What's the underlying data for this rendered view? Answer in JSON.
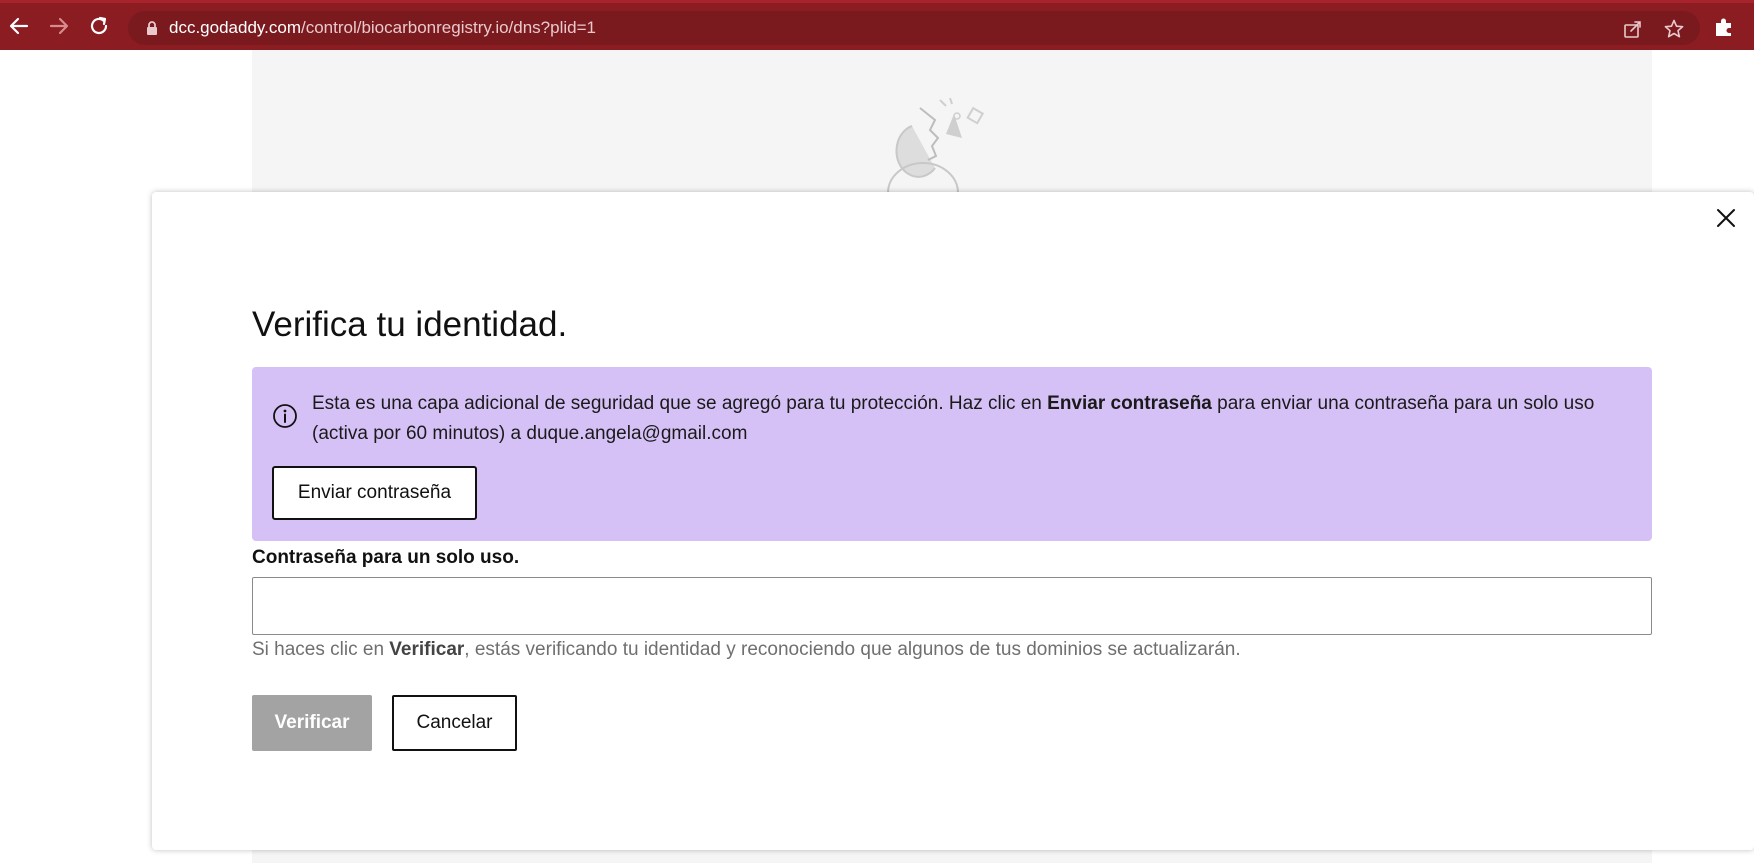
{
  "browser": {
    "url_host": "dcc.godaddy.com",
    "url_path": "/control/biocarbonregistry.io/dns?plid=1",
    "icons": {
      "back": "back-arrow-icon",
      "forward": "forward-arrow-icon",
      "reload": "reload-icon",
      "lock": "lock-icon",
      "share": "share-icon",
      "bookmark": "star-icon",
      "extensions": "puzzle-icon"
    }
  },
  "modal": {
    "title": "Verifica tu identidad.",
    "info": {
      "text_before": "Esta es una capa adicional de seguridad que se agregó para tu protección. Haz clic en ",
      "text_bold": "Enviar contraseña",
      "text_after": " para enviar una contraseña para un solo uso (activa por 60 minutos) a duque.angela@gmail.com",
      "send_button_label": "Enviar contraseña"
    },
    "otp_label": "Contraseña para un solo uso.",
    "otp_value": "",
    "hint": {
      "before": "Si haces clic en ",
      "bold": "Verificar",
      "after": ", estás verificando tu identidad y reconociendo que algunos de tus dominios se actualizarán."
    },
    "verify_label": "Verificar",
    "cancel_label": "Cancelar"
  },
  "colors": {
    "toolbar": "#8a1c22",
    "info_background": "#d6c1f7",
    "verify_disabled": "#a3a3a3"
  }
}
